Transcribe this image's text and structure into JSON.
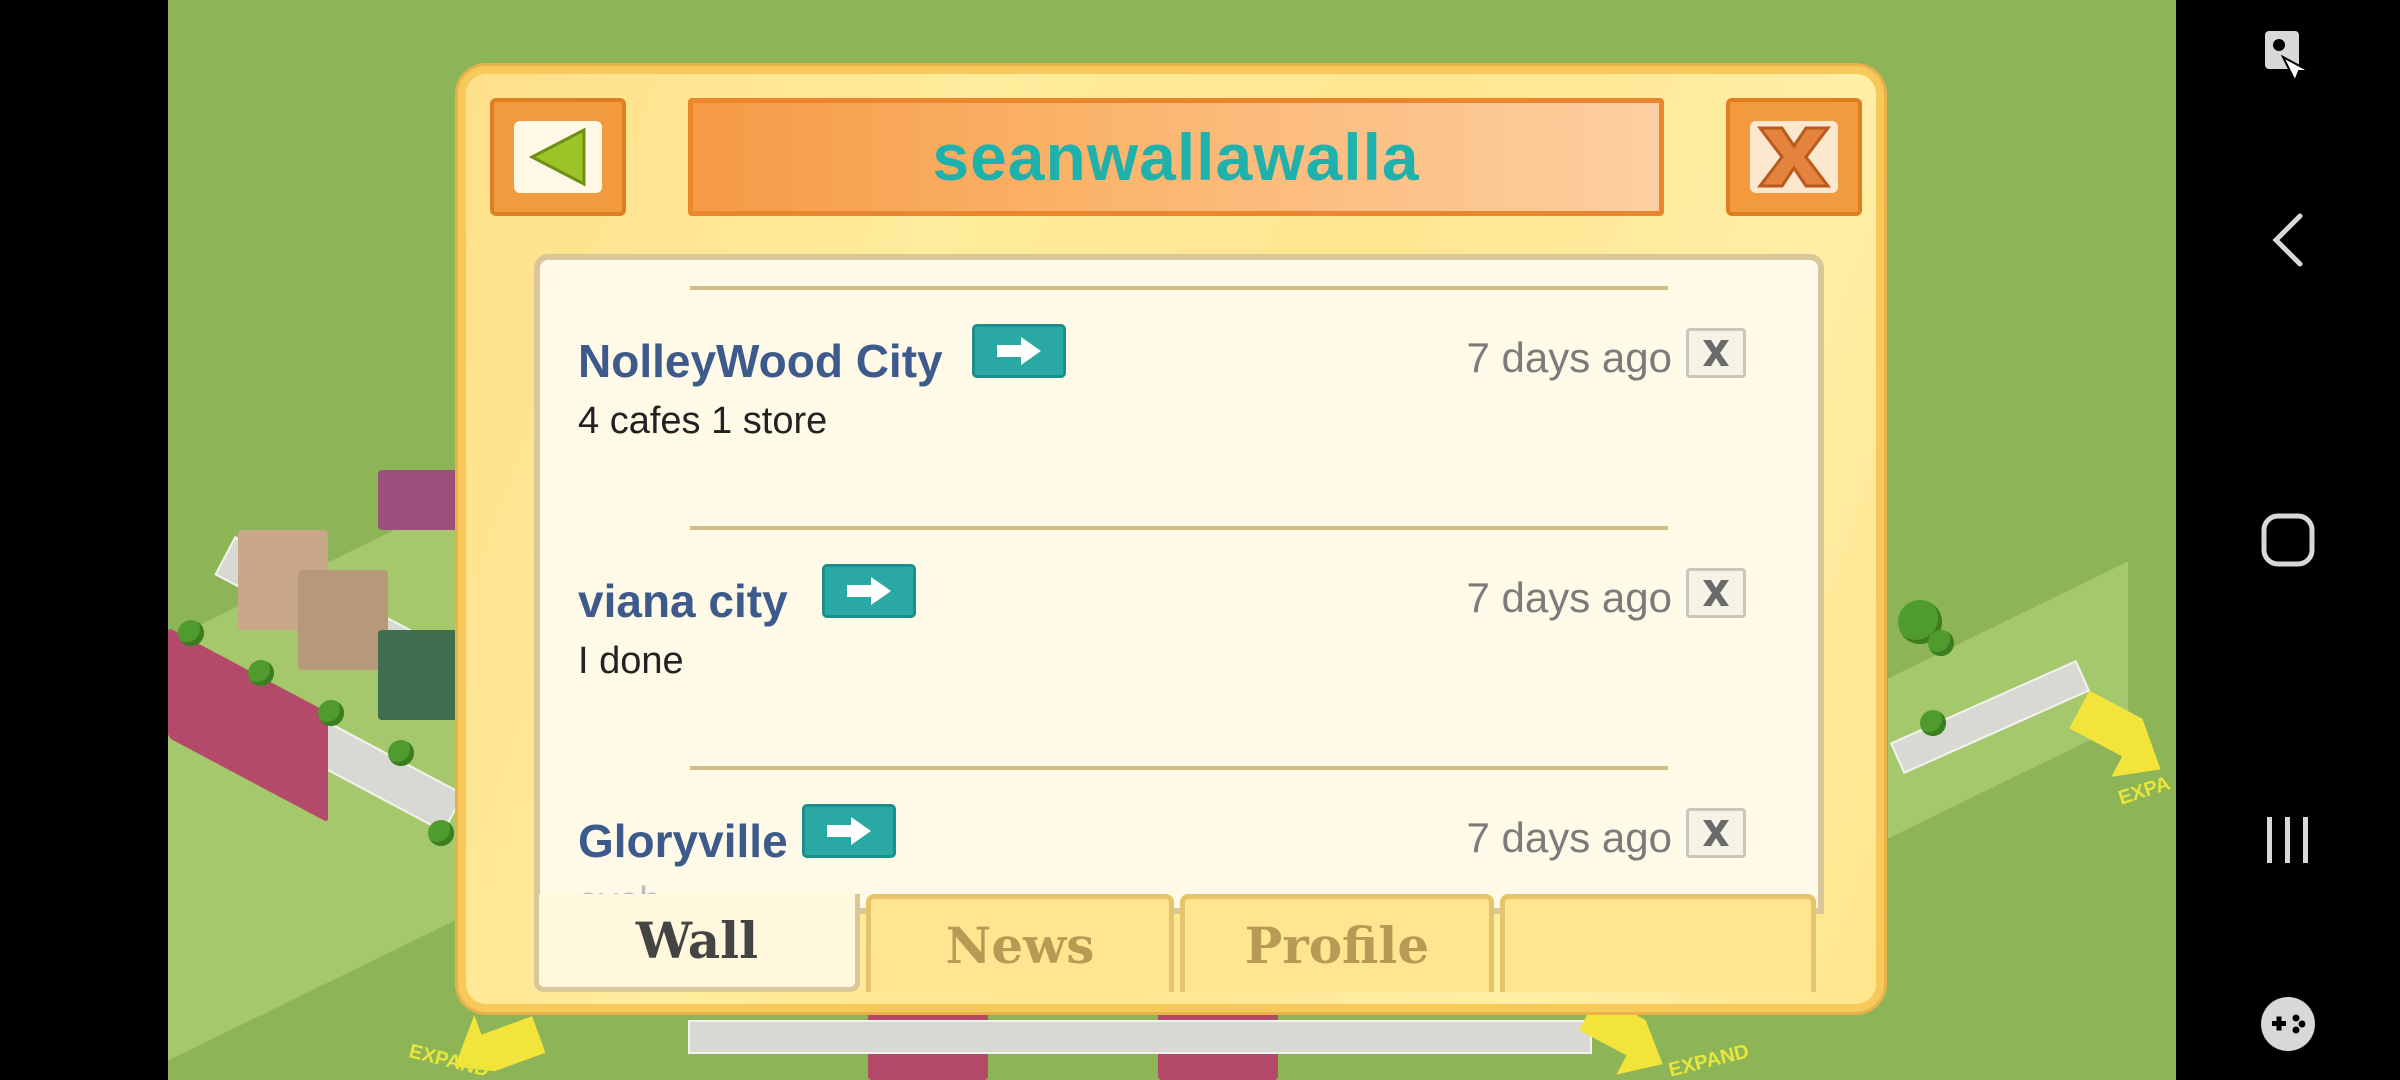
{
  "dialog": {
    "title": "seanwallawalla",
    "posts": [
      {
        "city": "NolleyWood City",
        "time": "7 days ago",
        "message": "4 cafes 1 store"
      },
      {
        "city": "viana city",
        "time": "7 days ago",
        "message": "I done"
      },
      {
        "city": "Gloryville",
        "time": "7 days ago",
        "message": "ayah"
      }
    ],
    "tabs": [
      {
        "label": "Wall",
        "active": true
      },
      {
        "label": "News",
        "active": false
      },
      {
        "label": "Profile",
        "active": false
      },
      {
        "label": "",
        "active": false
      }
    ]
  },
  "map": {
    "expand_left": "EXPAND",
    "expand_bottom": "EXPAND",
    "expand_right": "EXPA"
  },
  "icons": {
    "back": "back-arrow-icon",
    "close": "close-x-icon",
    "go": "right-arrow-icon",
    "delete": "delete-x-icon",
    "nav": [
      "screenshot-icon",
      "back-icon",
      "home-icon",
      "recents-icon",
      "game-launcher-icon"
    ]
  },
  "colors": {
    "title_text": "#1fb2ad",
    "city_name": "#3d5a8c",
    "go_button": "#2aa9a4",
    "dialog_bg": "#ffe690",
    "grass": "#8db456"
  }
}
